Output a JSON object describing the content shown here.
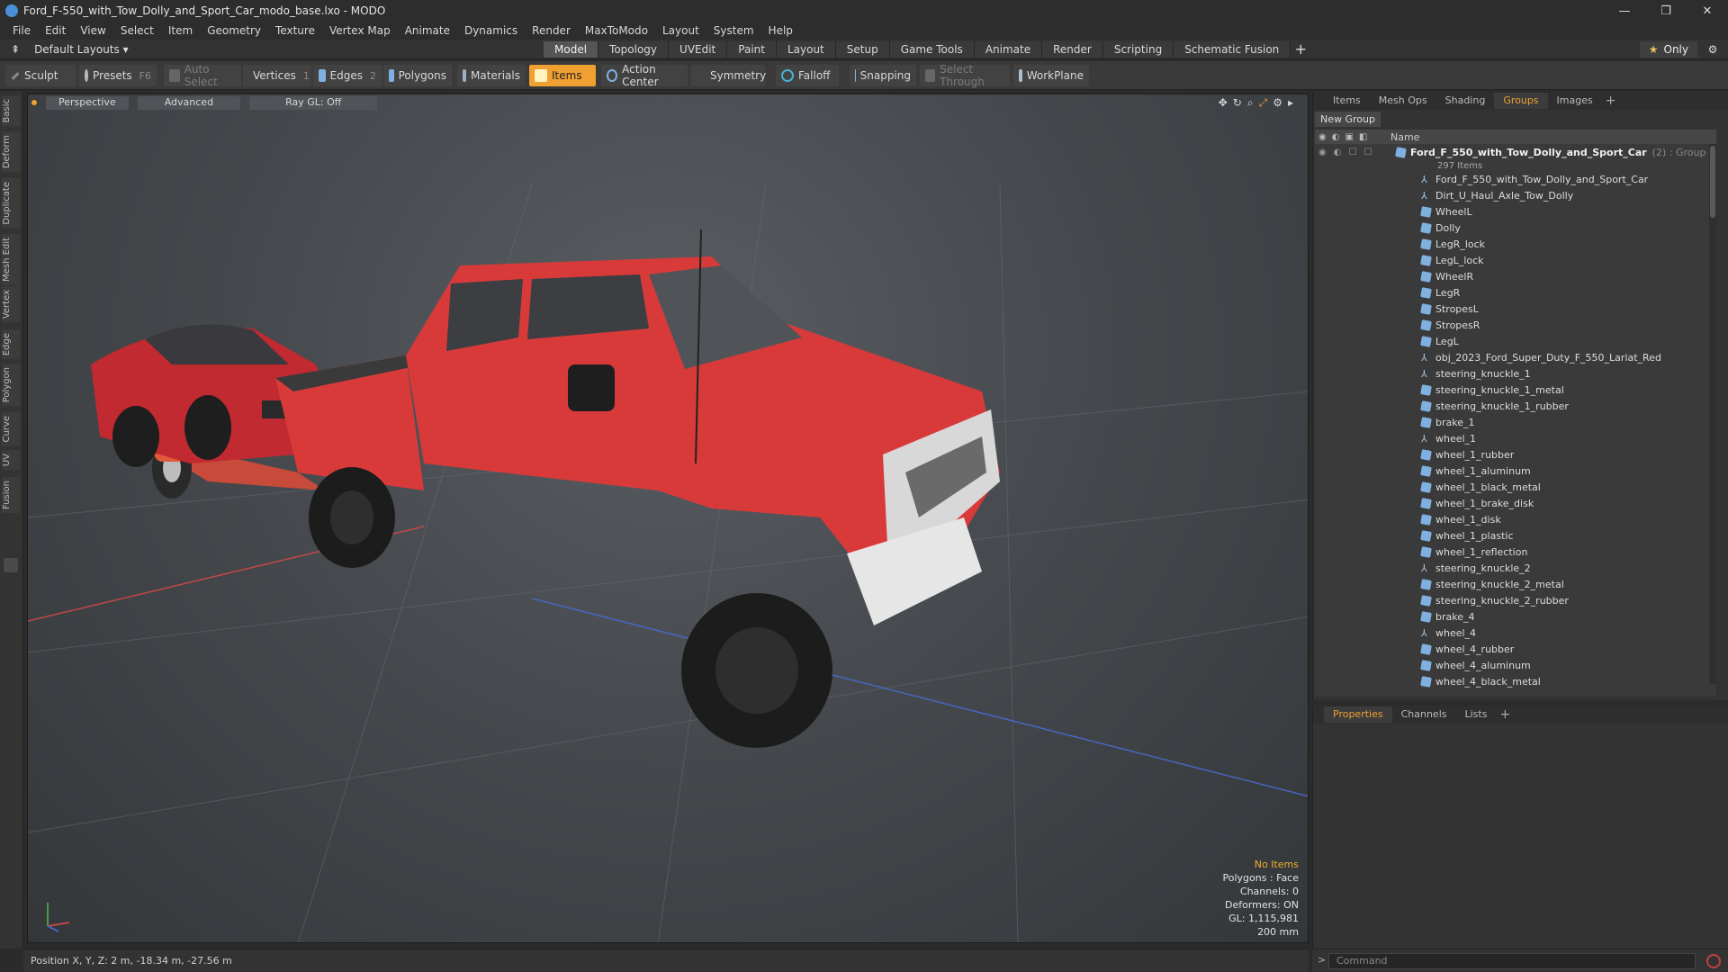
{
  "window": {
    "title": "Ford_F-550_with_Tow_Dolly_and_Sport_Car_modo_base.lxo - MODO",
    "minimize": "—",
    "restore": "❐",
    "close": "✕"
  },
  "menu": [
    "File",
    "Edit",
    "View",
    "Select",
    "Item",
    "Geometry",
    "Texture",
    "Vertex Map",
    "Animate",
    "Dynamics",
    "Render",
    "MaxToModo",
    "Layout",
    "System",
    "Help"
  ],
  "layoutbar": {
    "layout_select": "Default Layouts ▾",
    "tabs": [
      "Model",
      "Topology",
      "UVEdit",
      "Paint",
      "Layout",
      "Setup",
      "Game Tools",
      "Animate",
      "Render",
      "Scripting",
      "Schematic Fusion"
    ],
    "active_tab": "Model",
    "add": "+",
    "only_label": "Only",
    "star": "★"
  },
  "toolbar": {
    "sculpt": "Sculpt",
    "presets": "Presets",
    "presets_key": "F6",
    "auto_select": "Auto Select",
    "vertices": "Vertices",
    "vertices_key": "1",
    "edges": "Edges",
    "edges_key": "2",
    "polygons": "Polygons",
    "materials": "Materials",
    "items": "Items",
    "action_center": "Action Center",
    "symmetry": "Symmetry",
    "falloff": "Falloff",
    "snapping": "Snapping",
    "select_through": "Select Through",
    "workplane": "WorkPlane"
  },
  "left_tabs": [
    "Basic",
    "Deform",
    "Duplicate",
    "Mesh Edit",
    "Vertex",
    "Edge",
    "Polygon",
    "Curve",
    "UV",
    "Fusion"
  ],
  "viewport": {
    "view": "Perspective",
    "shading": "Advanced",
    "raygl": "Ray GL: Off",
    "info": {
      "no_items": "No Items",
      "polygons": "Polygons : Face",
      "channels": "Channels: 0",
      "deformers": "Deformers: ON",
      "gl": "GL: 1,115,981",
      "scale": "200 mm"
    }
  },
  "status": {
    "position": "Position X, Y, Z:  2 m, -18.34 m, -27.56 m"
  },
  "panel": {
    "tabs": [
      "Items",
      "Mesh Ops",
      "Shading",
      "Groups",
      "Images"
    ],
    "active_tab": "Groups",
    "new_group": "New Group",
    "name_col": "Name",
    "group_name": "Ford_F_550_with_Tow_Dolly_and_Sport_Car",
    "group_type": "(2) : Group",
    "group_count": "297 Items",
    "items": [
      {
        "name": "Ford_F_550_with_Tow_Dolly_and_Sport_Car",
        "kind": "locator"
      },
      {
        "name": "Dirt_U_Haul_Axle_Tow_Dolly",
        "kind": "locator"
      },
      {
        "name": "WheelL",
        "kind": "mesh"
      },
      {
        "name": "Dolly",
        "kind": "mesh"
      },
      {
        "name": "LegR_lock",
        "kind": "mesh"
      },
      {
        "name": "LegL_lock",
        "kind": "mesh"
      },
      {
        "name": "WheelR",
        "kind": "mesh"
      },
      {
        "name": "LegR",
        "kind": "mesh"
      },
      {
        "name": "StropesL",
        "kind": "mesh"
      },
      {
        "name": "StropesR",
        "kind": "mesh"
      },
      {
        "name": "LegL",
        "kind": "mesh"
      },
      {
        "name": "obj_2023_Ford_Super_Duty_F_550_Lariat_Red",
        "kind": "locator"
      },
      {
        "name": "steering_knuckle_1",
        "kind": "locator"
      },
      {
        "name": "steering_knuckle_1_metal",
        "kind": "mesh"
      },
      {
        "name": "steering_knuckle_1_rubber",
        "kind": "mesh"
      },
      {
        "name": "brake_1",
        "kind": "mesh"
      },
      {
        "name": "wheel_1",
        "kind": "locator"
      },
      {
        "name": "wheel_1_rubber",
        "kind": "mesh"
      },
      {
        "name": "wheel_1_aluminum",
        "kind": "mesh"
      },
      {
        "name": "wheel_1_black_metal",
        "kind": "mesh"
      },
      {
        "name": "wheel_1_brake_disk",
        "kind": "mesh"
      },
      {
        "name": "wheel_1_disk",
        "kind": "mesh"
      },
      {
        "name": "wheel_1_plastic",
        "kind": "mesh"
      },
      {
        "name": "wheel_1_reflection",
        "kind": "mesh"
      },
      {
        "name": "steering_knuckle_2",
        "kind": "locator"
      },
      {
        "name": "steering_knuckle_2_metal",
        "kind": "mesh"
      },
      {
        "name": "steering_knuckle_2_rubber",
        "kind": "mesh"
      },
      {
        "name": "brake_4",
        "kind": "mesh"
      },
      {
        "name": "wheel_4",
        "kind": "locator"
      },
      {
        "name": "wheel_4_rubber",
        "kind": "mesh"
      },
      {
        "name": "wheel_4_aluminum",
        "kind": "mesh"
      },
      {
        "name": "wheel_4_black_metal",
        "kind": "mesh"
      }
    ]
  },
  "props": {
    "tabs": [
      "Properties",
      "Channels",
      "Lists"
    ],
    "active_tab": "Properties"
  },
  "command": {
    "placeholder": "Command",
    "prompt": ">"
  },
  "colors": {
    "accent": "#f0a030",
    "truck_red": "#d83a3a",
    "car_red": "#c02a30"
  }
}
